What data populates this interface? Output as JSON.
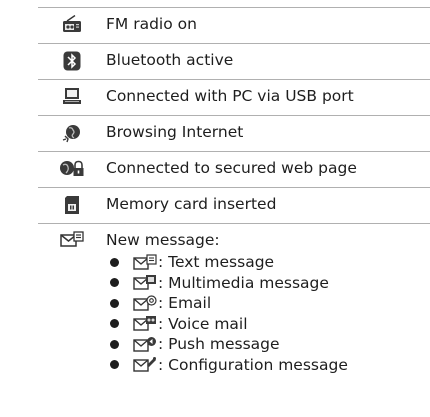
{
  "rows": [
    {
      "icon": "radio-icon",
      "label": "FM radio on"
    },
    {
      "icon": "bluetooth-icon",
      "label": "Bluetooth active"
    },
    {
      "icon": "pc-usb-icon",
      "label": "Connected with PC via USB port"
    },
    {
      "icon": "globe-browsing-icon",
      "label": "Browsing Internet"
    },
    {
      "icon": "globe-lock-icon",
      "label": "Connected to secured web page"
    },
    {
      "icon": "memory-card-icon",
      "label": "Memory card inserted"
    },
    {
      "icon": "envelope-icon",
      "label": "New message:"
    }
  ],
  "message_types": [
    {
      "icon": "envelope-text-icon",
      "label": ": Text message"
    },
    {
      "icon": "envelope-multimedia-icon",
      "label": ": Multimedia message"
    },
    {
      "icon": "envelope-email-icon",
      "label": ": Email"
    },
    {
      "icon": "envelope-voicemail-icon",
      "label": ": Voice mail"
    },
    {
      "icon": "envelope-push-icon",
      "label": ": Push message"
    },
    {
      "icon": "envelope-config-icon",
      "label": ": Configuration message"
    }
  ]
}
